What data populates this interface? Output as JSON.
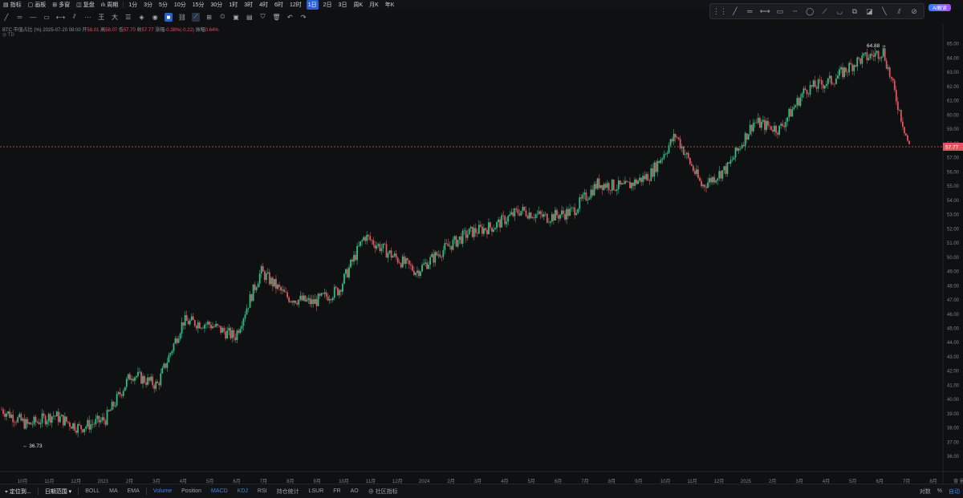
{
  "topbar": {
    "items": [
      "指标",
      "画板",
      "多窗",
      "复盘",
      "周期",
      "1分",
      "3分",
      "5分",
      "10分",
      "15分",
      "30分",
      "1时",
      "3时",
      "4时",
      "6时",
      "12时",
      "1日",
      "2日",
      "3日",
      "周K",
      "月K",
      "年K"
    ],
    "active": "1日"
  },
  "draw_tools": [
    "⋮⋮",
    "╱",
    "═",
    "⟷",
    "▭",
    "┄",
    "◯",
    "⟋",
    "◡",
    "⧉",
    "◪",
    "╲",
    "⫽",
    "⊘"
  ],
  "ai_badge": "AI解读",
  "legend": {
    "symbol": "BTC 市值占比 (%)",
    "date": "2025-07-20 08:00",
    "open_label": "开",
    "open": "58.01",
    "high_label": "高",
    "high": "58.07",
    "low_label": "低",
    "low": "57.70",
    "close_label": "收",
    "close": "57.77",
    "change_label": "涨幅",
    "change": "-0.38%(-0.22)",
    "amp_label": "振幅",
    "amp": "0.64%"
  },
  "legend2": "TD",
  "chart_data": {
    "type": "line",
    "y_range": [
      35.5,
      66
    ],
    "y_ticks": [
      "65.00",
      "64.00",
      "63.00",
      "62.00",
      "61.00",
      "60.00",
      "59.00",
      "58.00",
      "57.00",
      "56.00",
      "55.00",
      "54.00",
      "53.00",
      "52.00",
      "51.00",
      "50.00",
      "49.00",
      "48.00",
      "47.00",
      "46.00",
      "45.00",
      "44.00",
      "43.00",
      "42.00",
      "41.00",
      "40.00",
      "39.00",
      "38.00",
      "37.00",
      "36.00"
    ],
    "x_labels": [
      "10月",
      "11月",
      "12月",
      "2023",
      "2月",
      "3月",
      "4月",
      "5月",
      "6月",
      "7月",
      "8月",
      "9月",
      "10月",
      "11月",
      "12月",
      "2024",
      "2月",
      "3月",
      "4月",
      "5月",
      "6月",
      "7月",
      "8月",
      "9月",
      "10月",
      "11月",
      "12月",
      "2025",
      "2月",
      "3月",
      "4月",
      "5月",
      "6月",
      "7月",
      "8月"
    ],
    "series": [
      {
        "x": [
          "2022-09",
          "2022-10",
          "2022-11",
          "2022-12",
          "2023-01",
          "2023-02",
          "2023-03",
          "2023-04",
          "2023-05",
          "2023-06",
          "2023-07",
          "2023-08",
          "2023-09",
          "2023-10",
          "2023-11",
          "2023-12",
          "2024-01",
          "2024-02",
          "2024-03",
          "2024-04",
          "2024-05",
          "2024-06",
          "2024-07",
          "2024-08",
          "2024-09",
          "2024-10",
          "2024-11",
          "2024-12",
          "2025-01",
          "2025-02",
          "2025-03",
          "2025-04",
          "2025-05",
          "2025-06",
          "2025-07",
          "2025-07-20"
        ],
        "values": [
          39.3,
          38.2,
          38.9,
          38.0,
          38.6,
          41.8,
          41.0,
          45.5,
          45.3,
          44.4,
          49.0,
          47.2,
          46.8,
          47.7,
          51.5,
          50.2,
          49.0,
          50.5,
          51.7,
          52.2,
          53.3,
          52.8,
          53.2,
          55.2,
          54.9,
          55.8,
          58.6,
          55.0,
          56.3,
          59.5,
          59.0,
          61.8,
          62.4,
          63.8,
          64.5,
          57.77
        ]
      }
    ],
    "high_label": "64.88",
    "low_label": "36.73",
    "current_price": "57.77",
    "colors": {
      "up": "#2ebd85",
      "down": "#e05560",
      "line": "#8aa7a0",
      "price_line": "#e05560"
    },
    "grid": false
  },
  "bottombar": {
    "left": [
      "定位到...",
      "日期范围"
    ],
    "indicators": [
      "BOLL",
      "MA",
      "EMA",
      "Volume",
      "Position",
      "MACD",
      "KDJ",
      "RSI",
      "持仓统计",
      "LSUR",
      "FR",
      "AO",
      "社区指标"
    ],
    "active_indicators": [
      "Volume",
      "MACD",
      "KDJ"
    ],
    "right": [
      "对数",
      "%",
      "自动"
    ]
  },
  "axis_footer": [
    "背",
    "景"
  ]
}
